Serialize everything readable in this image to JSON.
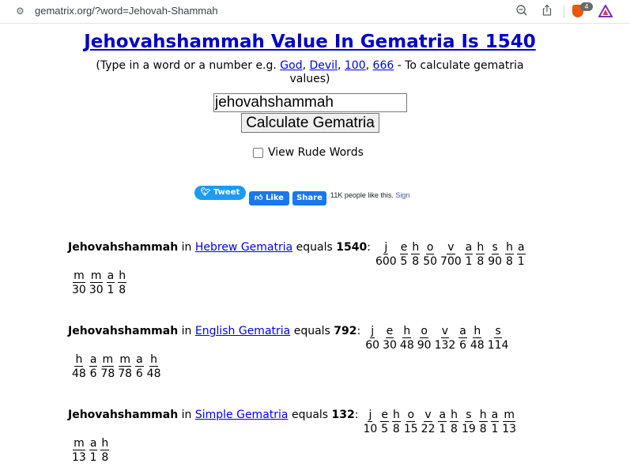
{
  "browser": {
    "url": "gematrix.org/?word=Jehovah-Shammah",
    "shield_count": "4",
    "colors": {
      "brave_orange": "#e8590c"
    }
  },
  "page": {
    "title": "Jehovahshammah Value In Gematria Is 1540",
    "intro": {
      "prefix": "(Type in a word or a number e.g. ",
      "links": [
        "God",
        "Devil",
        "100",
        "666"
      ],
      "suffix": " - To calculate gematria values)"
    },
    "input_value": "jehovahshammah",
    "calculate_label": "Calculate Gematria",
    "rude_label": "View Rude Words"
  },
  "social": {
    "tweet": "Tweet",
    "like": "Like",
    "share": "Share",
    "people": "11K people like this.",
    "signup": "Sign"
  },
  "results": [
    {
      "word": "Jehovahshammah",
      "in": "in",
      "method": "Hebrew Gematria",
      "equals": "equals",
      "total": "1540",
      "rows": [
        [
          [
            "j",
            "600"
          ],
          [
            "e",
            "5"
          ],
          [
            "h",
            "8"
          ],
          [
            "o",
            "50"
          ],
          [
            "v",
            "700"
          ],
          [
            "a",
            "1"
          ],
          [
            "h",
            "8"
          ],
          [
            "s",
            "90"
          ],
          [
            "h",
            "8"
          ],
          [
            "a",
            "1"
          ]
        ],
        [
          [
            "m",
            "30"
          ],
          [
            "m",
            "30"
          ],
          [
            "a",
            "1"
          ],
          [
            "h",
            "8"
          ]
        ]
      ]
    },
    {
      "word": "Jehovahshammah",
      "in": "in",
      "method": "English Gematria",
      "equals": "equals",
      "total": "792",
      "rows": [
        [
          [
            "j",
            "60"
          ],
          [
            "e",
            "30"
          ],
          [
            "h",
            "48"
          ],
          [
            "o",
            "90"
          ],
          [
            "v",
            "132"
          ],
          [
            "a",
            "6"
          ],
          [
            "h",
            "48"
          ],
          [
            "s",
            "114"
          ]
        ],
        [
          [
            "h",
            "48"
          ],
          [
            "a",
            "6"
          ],
          [
            "m",
            "78"
          ],
          [
            "m",
            "78"
          ],
          [
            "a",
            "6"
          ],
          [
            "h",
            "48"
          ]
        ]
      ]
    },
    {
      "word": "Jehovahshammah",
      "in": "in",
      "method": "Simple Gematria",
      "equals": "equals",
      "total": "132",
      "rows": [
        [
          [
            "j",
            "10"
          ],
          [
            "e",
            "5"
          ],
          [
            "h",
            "8"
          ],
          [
            "o",
            "15"
          ],
          [
            "v",
            "22"
          ],
          [
            "a",
            "1"
          ],
          [
            "h",
            "8"
          ],
          [
            "s",
            "19"
          ],
          [
            "h",
            "8"
          ],
          [
            "a",
            "1"
          ],
          [
            "m",
            "13"
          ]
        ],
        [
          [
            "m",
            "13"
          ],
          [
            "a",
            "1"
          ],
          [
            "h",
            "8"
          ]
        ]
      ]
    }
  ]
}
